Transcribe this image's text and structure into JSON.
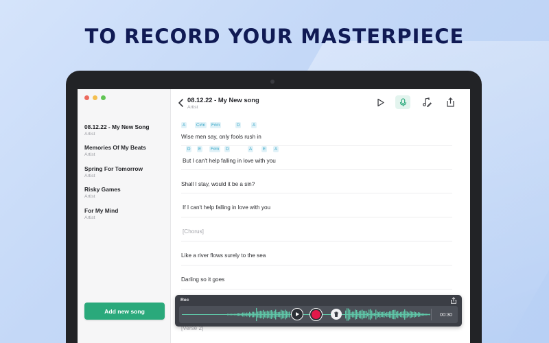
{
  "headline": "TO RECORD YOUR MASTERPIECE",
  "sidebar": {
    "songs": [
      {
        "title": "08.12.22 - My New Song",
        "artist": "Artist",
        "active": true
      },
      {
        "title": "Memories Of My Beats",
        "artist": "Artist"
      },
      {
        "title": "Spring For Tomorrow",
        "artist": "Artist"
      },
      {
        "title": "Risky Games",
        "artist": "Artist"
      },
      {
        "title": "For My Mind",
        "artist": "Artist"
      }
    ],
    "add_button": "Add new song"
  },
  "editor": {
    "title": "08.12.22 - My New song",
    "artist": "Artist",
    "lyrics": [
      {
        "text": "Wise men say, only fools rush in",
        "chords": [
          "A",
          "C#m",
          "F#m",
          "D",
          "A"
        ]
      },
      {
        "text": "But I can't help falling in love with you",
        "chords": [
          "D",
          "E",
          "F#m",
          "D",
          "A",
          "E",
          "A"
        ]
      },
      {
        "text": "Shall I  stay, would it be a sin?",
        "chords": []
      },
      {
        "text": "If I can't help falling in love with you",
        "chords": []
      },
      {
        "text": "[Chorus]",
        "chords": [],
        "section": true
      },
      {
        "text": "Like a river flows surely to the sea",
        "chords": []
      },
      {
        "text": "Darling so it goes",
        "chords": []
      }
    ],
    "next_section": "[Verse 2]"
  },
  "recorder": {
    "label": "Rec",
    "time": "00:30"
  },
  "colors": {
    "accent": "#2aa97b",
    "record": "#e3184a",
    "chord": "#2ea3c4"
  }
}
